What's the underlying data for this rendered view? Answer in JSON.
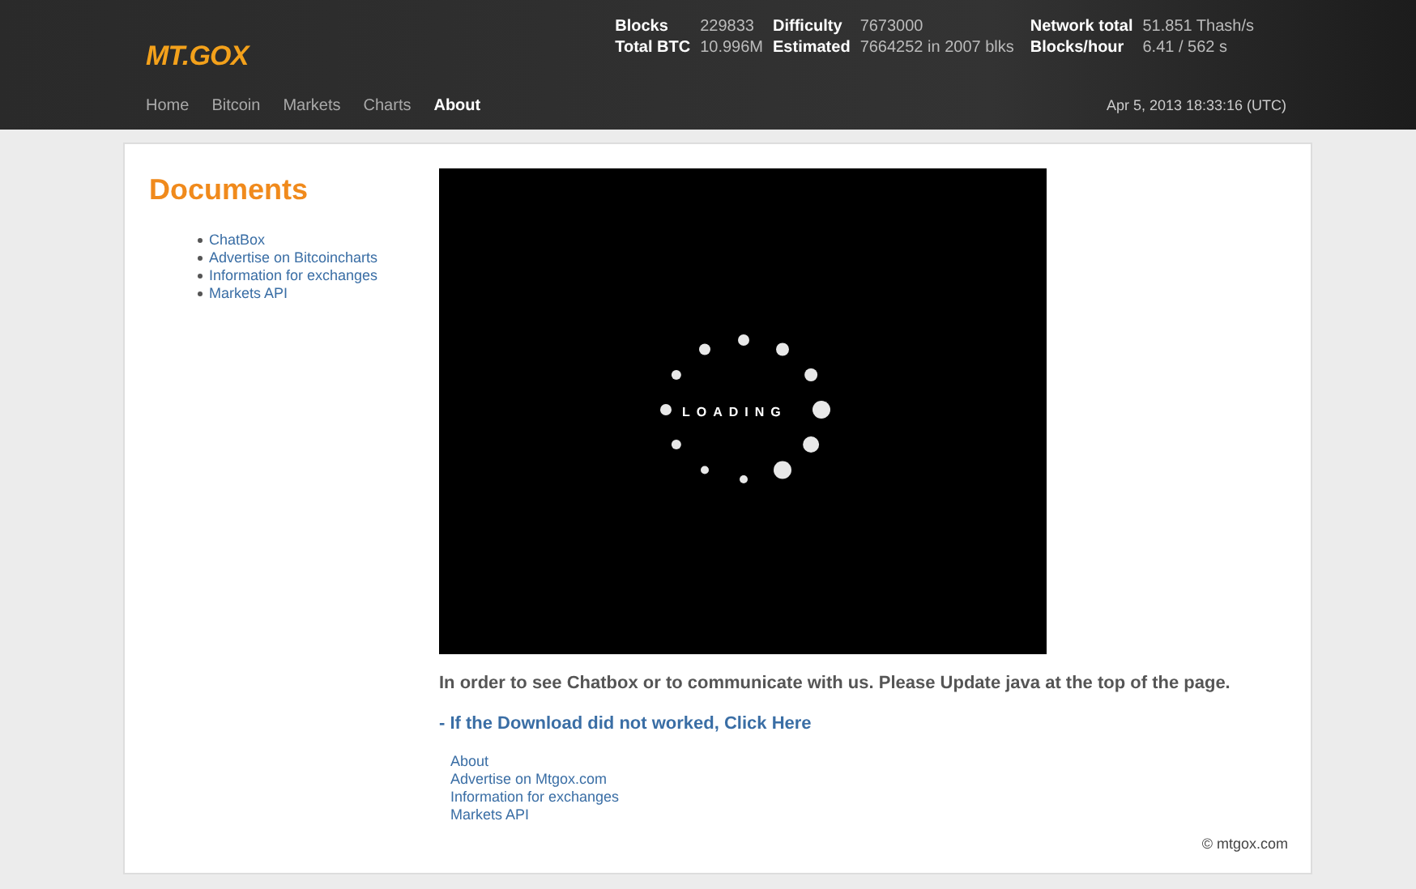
{
  "header": {
    "logo": "MT.GOX",
    "stats": [
      {
        "label": "Blocks",
        "value": "229833"
      },
      {
        "label": "Difficulty",
        "value": "7673000"
      },
      {
        "label": "Network total",
        "value": "51.851 Thash/s"
      },
      {
        "label": "Total BTC",
        "value": "10.996M"
      },
      {
        "label": "Estimated",
        "value": "7664252 in 2007 blks"
      },
      {
        "label": "Blocks/hour",
        "value": "6.41 / 562 s"
      }
    ],
    "nav": [
      {
        "label": "Home",
        "selected": false
      },
      {
        "label": "Bitcoin",
        "selected": false
      },
      {
        "label": "Markets",
        "selected": false
      },
      {
        "label": "Charts",
        "selected": false
      },
      {
        "label": "About",
        "selected": true
      }
    ],
    "datetime": "Apr 5, 2013 18:33:16 (UTC)"
  },
  "sidebar": {
    "title": "Documents",
    "items": [
      "ChatBox",
      "Advertise on Bitcoincharts",
      "Information for exchanges",
      "Markets API"
    ]
  },
  "applet": {
    "loading_text": "LOADING"
  },
  "message": "In order to see Chatbox or to communicate with us. Please Update java at the top of the page.",
  "download_link": "- If the Download did not worked, Click Here",
  "footer_links": [
    "About",
    "Advertise on Mtgox.com",
    "Information for exchanges",
    "Markets API"
  ],
  "copyright": "© mtgox.com"
}
